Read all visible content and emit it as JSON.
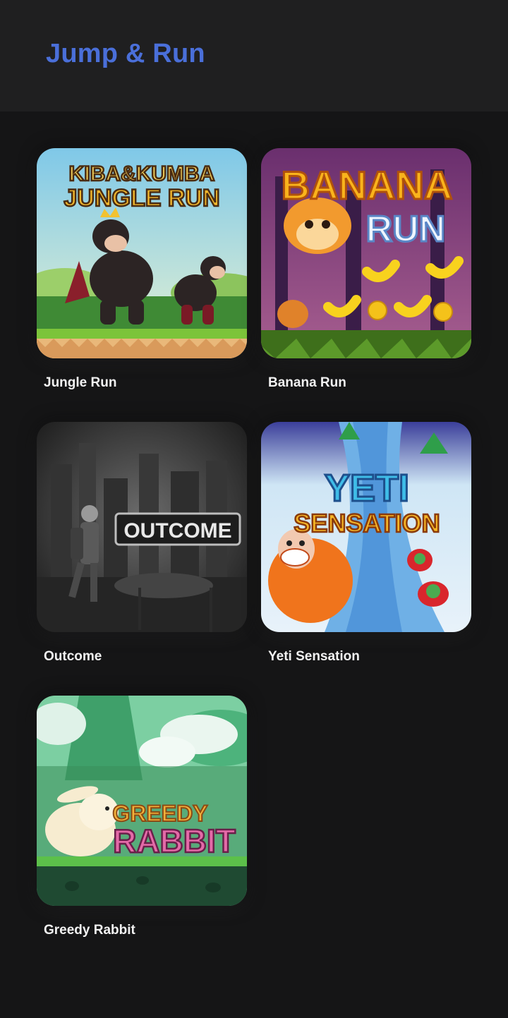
{
  "header": {
    "title": "Jump & Run",
    "title_color": "#4a6fd9"
  },
  "games": [
    {
      "title": "Jungle Run",
      "logo_line1": "KIBA&KUMBA",
      "logo_line2": "JUNGLE RUN"
    },
    {
      "title": "Banana Run",
      "logo_line1": "BANANA",
      "logo_line2": "RUN"
    },
    {
      "title": "Outcome",
      "logo_line1": "OUTCOME"
    },
    {
      "title": "Yeti Sensation",
      "logo_line1": "YETI",
      "logo_line2": "SENSATION"
    },
    {
      "title": "Greedy Rabbit",
      "logo_line1": "GREEDY",
      "logo_line2": "RABBIT"
    }
  ]
}
